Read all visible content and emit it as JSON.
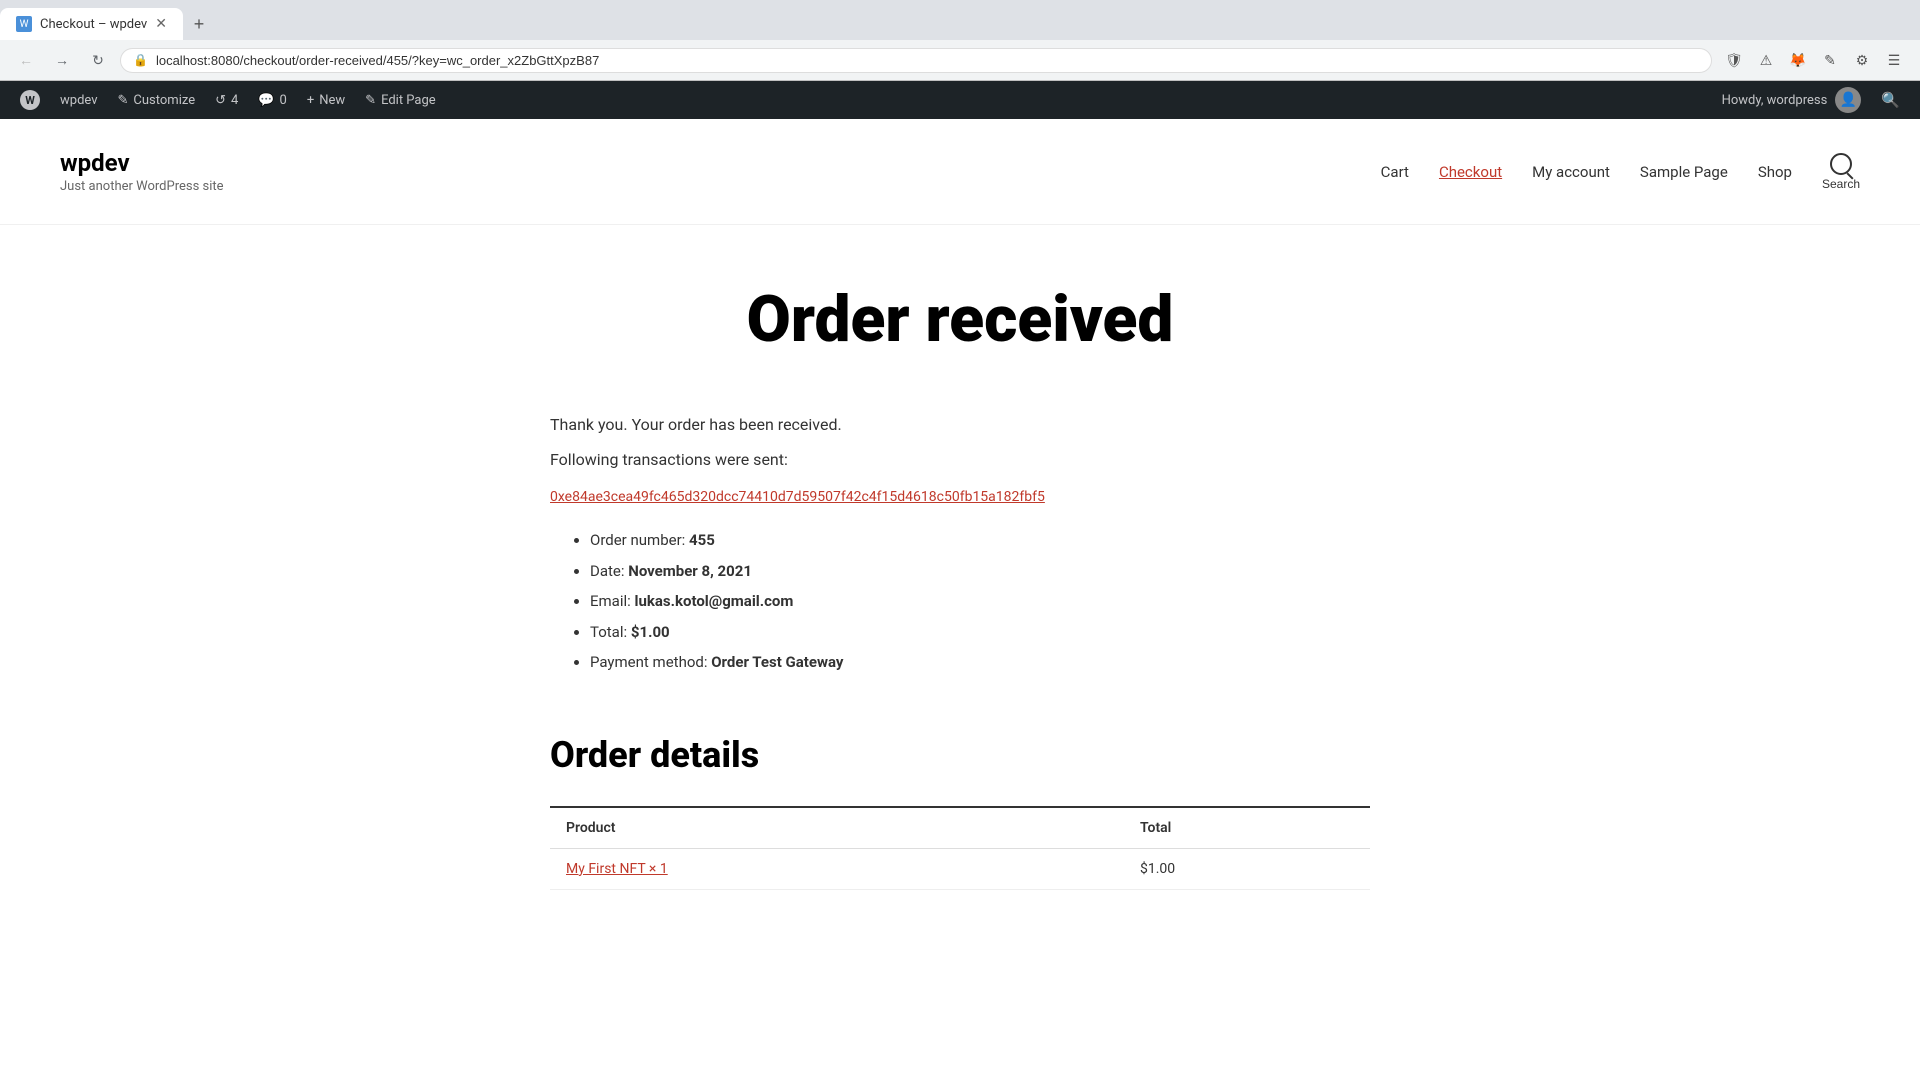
{
  "browser": {
    "tab_title": "Checkout – wpdev",
    "url": "localhost:8080/checkout/order-received/455/?key=wc_order_x2ZbGttXpzB87",
    "new_tab_tooltip": "New tab"
  },
  "wp_admin_bar": {
    "wp_logo": "W",
    "site_name": "wpdev",
    "customize_label": "Customize",
    "revisions_label": "4",
    "comments_label": "0",
    "new_label": "New",
    "edit_page_label": "Edit Page",
    "howdy_label": "Howdy, wordpress"
  },
  "site_header": {
    "site_title": "wpdev",
    "site_description": "Just another WordPress site",
    "nav": {
      "cart": "Cart",
      "checkout": "Checkout",
      "my_account": "My account",
      "sample_page": "Sample Page",
      "shop": "Shop",
      "search": "Search"
    }
  },
  "main": {
    "page_title": "Order received",
    "thank_you": "Thank you. Your order has been received.",
    "following_transactions": "Following transactions were sent:",
    "transaction_hash": "0xe84ae3cea49fc465d320dcc74410d7d59507f42c4f15d4618c50fb15a182fbf5",
    "order_info": {
      "order_number_label": "Order number:",
      "order_number_value": "455",
      "date_label": "Date:",
      "date_value": "November 8, 2021",
      "email_label": "Email:",
      "email_value": "lukas.kotol@gmail.com",
      "total_label": "Total:",
      "total_value": "$1.00",
      "payment_method_label": "Payment method:",
      "payment_method_value": "Order Test Gateway"
    },
    "order_details": {
      "title": "Order details",
      "product_col": "Product",
      "total_col": "Total"
    }
  }
}
